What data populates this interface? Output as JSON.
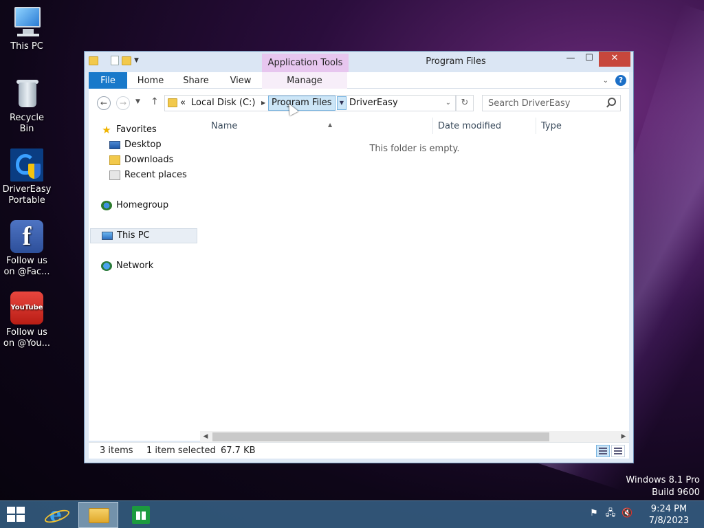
{
  "desktop": {
    "icons": [
      {
        "label": "This PC"
      },
      {
        "label": "Recycle Bin"
      },
      {
        "label": "DriverEasy Portable"
      },
      {
        "label": "Follow us on @Fac..."
      },
      {
        "label": "Follow us on @You..."
      }
    ],
    "youtube_badge": "YouTube",
    "watermark_line1": "Windows 8.1 Pro",
    "watermark_line2": "Build 9600"
  },
  "window": {
    "title": "Program Files",
    "context_tab": "Application Tools",
    "controls": {
      "minimize": "—",
      "maximize": "☐",
      "close": "✕"
    },
    "ribbon": {
      "tabs": [
        {
          "label": "File"
        },
        {
          "label": "Home"
        },
        {
          "label": "Share"
        },
        {
          "label": "View"
        },
        {
          "label": "Manage"
        }
      ],
      "help": "?"
    },
    "address": {
      "overflow": "«",
      "crumbs": [
        "Local Disk (C:)",
        "Program Files",
        "DriverEasy"
      ],
      "highlighted_crumb": "Program Files"
    },
    "search": {
      "placeholder": "Search DriverEasy"
    },
    "nav_pane": {
      "favorites": "Favorites",
      "favorites_items": [
        "Desktop",
        "Downloads",
        "Recent places"
      ],
      "homegroup": "Homegroup",
      "this_pc": "This PC",
      "network": "Network"
    },
    "content": {
      "columns": [
        "Name",
        "Date modified",
        "Type"
      ],
      "empty_message": "This folder is empty."
    },
    "status": {
      "items": "3 items",
      "selected": "1 item selected",
      "size": "67.7 KB"
    }
  },
  "taskbar": {
    "time": "9:24 PM",
    "date": "7/8/2023"
  },
  "colors": {
    "file_tab": "#1979ca",
    "context_tab": "#e7c6ef",
    "close_button": "#c7473c",
    "taskbar": "#3c6e96"
  }
}
